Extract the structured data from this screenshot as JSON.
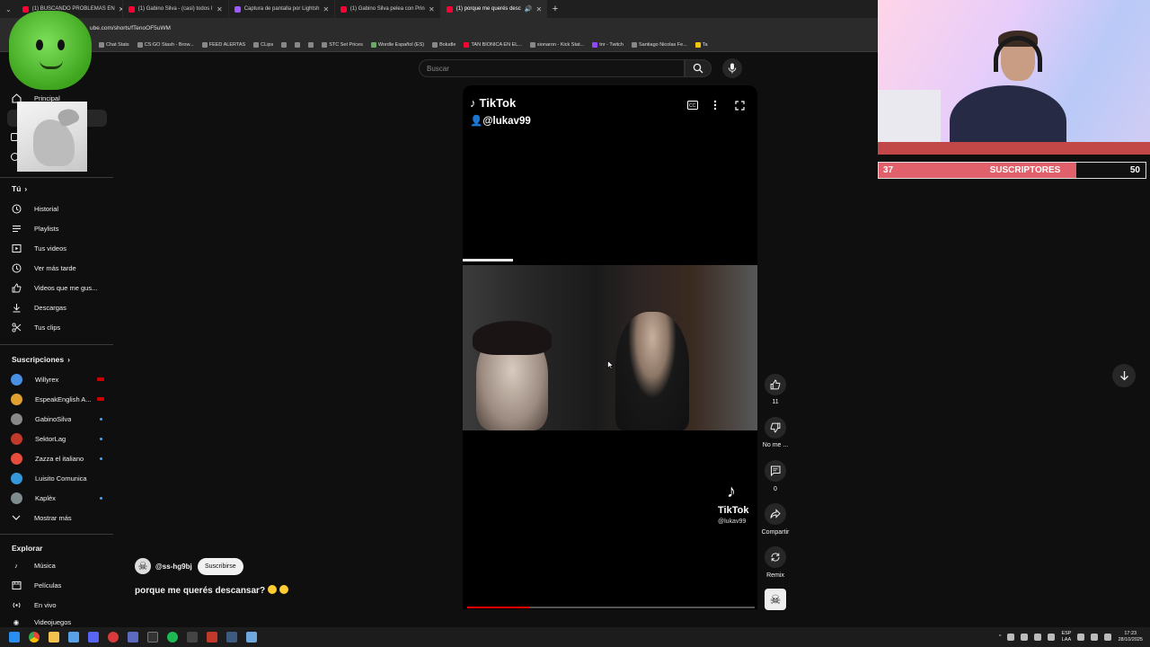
{
  "browser": {
    "tabs": [
      {
        "title": "(1) BUSCANDO PROBLEMAS EN",
        "color": "#ff0033"
      },
      {
        "title": "(1) Gabino Silva - (casi) todos l",
        "color": "#ff0033"
      },
      {
        "title": "Captura de pantalla por Lightsh",
        "color": "#9b59ff"
      },
      {
        "title": "(1) Gabino Silva pelea con Prin",
        "color": "#ff0033"
      },
      {
        "title": "(1) porque me querés desc",
        "color": "#ff0033",
        "active": true
      }
    ],
    "new_tab": "+",
    "url": "ube.com/shorts/fTenoOF5uWM",
    "bookmarks": [
      "Chat Stats",
      "CS:GO Stash - Brow...",
      "FEED ALERTAS",
      "CLips",
      "STC Set Prices",
      "Wordle Español (ES)",
      "Boludle",
      "TAN BIONICA EN EL...",
      "sionaron - Kick Stat...",
      "tnr - Twitch",
      "Santiago Nicolas Fe...",
      "Ta"
    ]
  },
  "search": {
    "placeholder": "Buscar"
  },
  "sidebar": {
    "home": "Principal",
    "you_header": "Tú",
    "you_items": [
      "Historial",
      "Playlists",
      "Tus videos",
      "Ver más tarde",
      "Videos que me gus...",
      "Descargas",
      "Tus clips"
    ],
    "subs_header": "Suscripciones",
    "subscriptions": [
      {
        "name": "Willyrex",
        "color": "#4a90e2",
        "badge": "live"
      },
      {
        "name": "EspeakEnglish A...",
        "color": "#e0a030",
        "badge": "live"
      },
      {
        "name": "GabinoSilva",
        "color": "#888888",
        "badge": "dot"
      },
      {
        "name": "SektorLag",
        "color": "#c0392b",
        "badge": "dot"
      },
      {
        "name": "Zazza el italiano",
        "color": "#e74c3c",
        "badge": "dot"
      },
      {
        "name": "Luisito Comunica",
        "color": "#3498db",
        "badge": "none"
      },
      {
        "name": "Kaplèx",
        "color": "#7f8c8d",
        "badge": "dot"
      }
    ],
    "show_more": "Mostrar más",
    "explore_header": "Explorar",
    "explore_items": [
      "Música",
      "Películas",
      "En vivo",
      "Videojuegos"
    ]
  },
  "video": {
    "brand_top": "TikTok",
    "user_top": "@lukav99",
    "brand_bottom": "TikTok",
    "user_bottom": "@lukav99",
    "progress": 0.22
  },
  "actions": {
    "likes": "11",
    "dislike_label": "No me ...",
    "comments": "0",
    "share_label": "Compartir",
    "remix_label": "Remix"
  },
  "channel": {
    "handle": "@ss-hg9bj",
    "subscribe_label": "Suscribirse"
  },
  "short_title": "porque me querés descansar?",
  "stream_overlay": {
    "sub_current": "37",
    "sub_label": "SUSCRIPTORES",
    "sub_goal": "50",
    "progress": 0.74
  },
  "taskbar": {
    "lang": "ESP",
    "lang_sub": "LAA",
    "time": "17:23",
    "date": "28/10/2025"
  }
}
